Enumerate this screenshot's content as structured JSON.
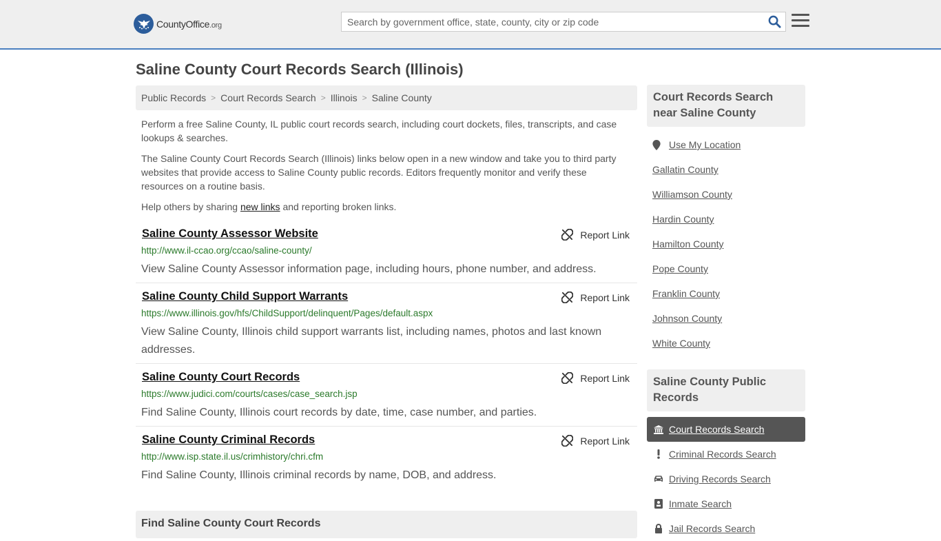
{
  "header": {
    "logo_brand": "CountyOffice",
    "logo_tld": ".org",
    "search_placeholder": "Search by government office, state, county, city or zip code"
  },
  "page_title": "Saline County Court Records Search (Illinois)",
  "breadcrumb": [
    "Public Records",
    "Court Records Search",
    "Illinois",
    "Saline County"
  ],
  "intro": {
    "p1": "Perform a free Saline County, IL public court records search, including court dockets, files, transcripts, and case lookups & searches.",
    "p2": "The Saline County Court Records Search (Illinois) links below open in a new window and take you to third party websites that provide access to Saline County public records. Editors frequently monitor and verify these resources on a routine basis.",
    "p3_before": "Help others by sharing ",
    "p3_link": "new links",
    "p3_after": " and reporting broken links."
  },
  "report_label": "Report Link",
  "results": [
    {
      "title": "Saline County Assessor Website",
      "url": "http://www.il-ccao.org/ccao/saline-county/",
      "desc": "View Saline County Assessor information page, including hours, phone number, and address."
    },
    {
      "title": "Saline County Child Support Warrants",
      "url": "https://www.illinois.gov/hfs/ChildSupport/delinquent/Pages/default.aspx",
      "desc": "View Saline County, Illinois child support warrants list, including names, photos and last known addresses."
    },
    {
      "title": "Saline County Court Records",
      "url": "https://www.judici.com/courts/cases/case_search.jsp",
      "desc": "Find Saline County, Illinois court records by date, time, case number, and parties."
    },
    {
      "title": "Saline County Criminal Records",
      "url": "http://www.isp.state.il.us/crimhistory/chri.cfm",
      "desc": "Find Saline County, Illinois criminal records by name, DOB, and address."
    }
  ],
  "bottom_heading": "Find Saline County Court Records",
  "sidebar": {
    "nearby_heading": "Court Records Search near Saline County",
    "use_location": "Use My Location",
    "nearby": [
      "Gallatin County",
      "Williamson County",
      "Hardin County",
      "Hamilton County",
      "Pope County",
      "Franklin County",
      "Johnson County",
      "White County"
    ],
    "public_heading": "Saline County Public Records",
    "public_links": [
      {
        "label": "Court Records Search",
        "icon": "courthouse-icon",
        "active": true
      },
      {
        "label": "Criminal Records Search",
        "icon": "exclamation-icon",
        "active": false
      },
      {
        "label": "Driving Records Search",
        "icon": "car-icon",
        "active": false
      },
      {
        "label": "Inmate Search",
        "icon": "id-badge-icon",
        "active": false
      },
      {
        "label": "Jail Records Search",
        "icon": "lock-icon",
        "active": false
      }
    ]
  },
  "colors": {
    "accent_blue": "#4a7fbf",
    "url_green": "#2b7a2b",
    "panel_gray": "#efefef",
    "active_item": "#555555"
  }
}
